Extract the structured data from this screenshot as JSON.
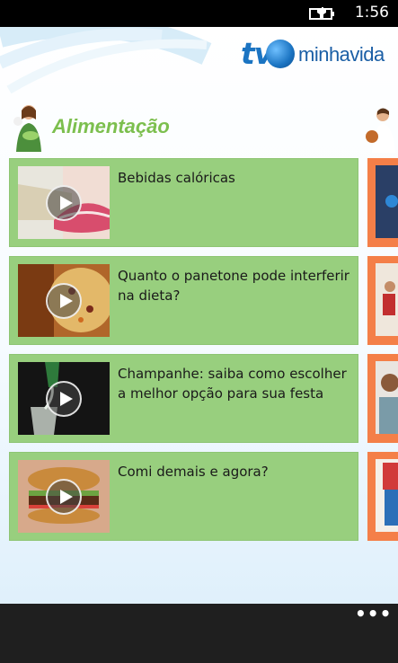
{
  "status_bar": {
    "time": "1:56"
  },
  "header": {
    "logo_prefix": "tv",
    "logo_text": "minhavida"
  },
  "section": {
    "title": "Alimentação"
  },
  "videos": [
    {
      "title": "Bebidas calóricas",
      "thumb": "lips-drinking"
    },
    {
      "title": "Quanto o panetone pode interferir na dieta?",
      "thumb": "panettone"
    },
    {
      "title": "Champanhe: saiba como escolher a melhor opção para sua festa",
      "thumb": "champagne-pour"
    },
    {
      "title": "Comi demais e agora?",
      "thumb": "hamburger"
    }
  ],
  "app_bar": {
    "more_label": "•••"
  },
  "colors": {
    "card": "#98cf7e",
    "side_card": "#f47f48",
    "title": "#7cbf4e",
    "logo": "#1b74c2"
  }
}
